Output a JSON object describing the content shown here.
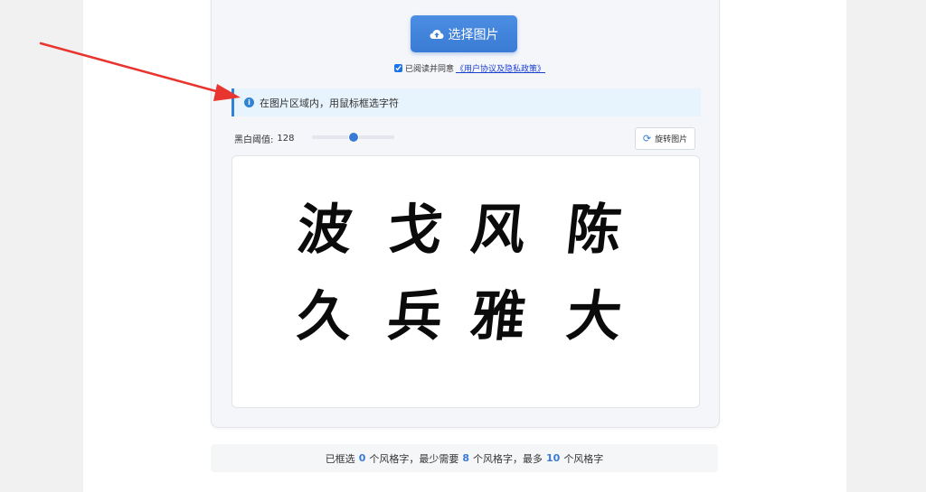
{
  "upload": {
    "label": "选择图片",
    "icon": "cloud-upload-icon"
  },
  "agreement": {
    "checked": true,
    "text": "已阅读并同意",
    "link": "《用户协议及隐私政策》"
  },
  "info": {
    "icon": "info-icon",
    "text": "在图片区域内，用鼠标框选字符"
  },
  "threshold": {
    "label": "黑白阈值:",
    "value": "128",
    "slider_fraction": 0.5
  },
  "rotate": {
    "label": "旋转图片",
    "icon": "rotate-icon"
  },
  "image": {
    "rows": [
      [
        "波",
        "戈",
        "风",
        "陈"
      ],
      [
        "久",
        "兵",
        "雅",
        "大"
      ]
    ]
  },
  "status": {
    "prefix": "已框选",
    "selected": "0",
    "part1": "个风格字，最少需要",
    "min": "8",
    "part2": "个风格字，最多",
    "max": "10",
    "part3": "个风格字"
  },
  "colors": {
    "accent": "#3a7bd5",
    "arrow": "#e8352f",
    "info_bg": "#e8f4fd"
  }
}
